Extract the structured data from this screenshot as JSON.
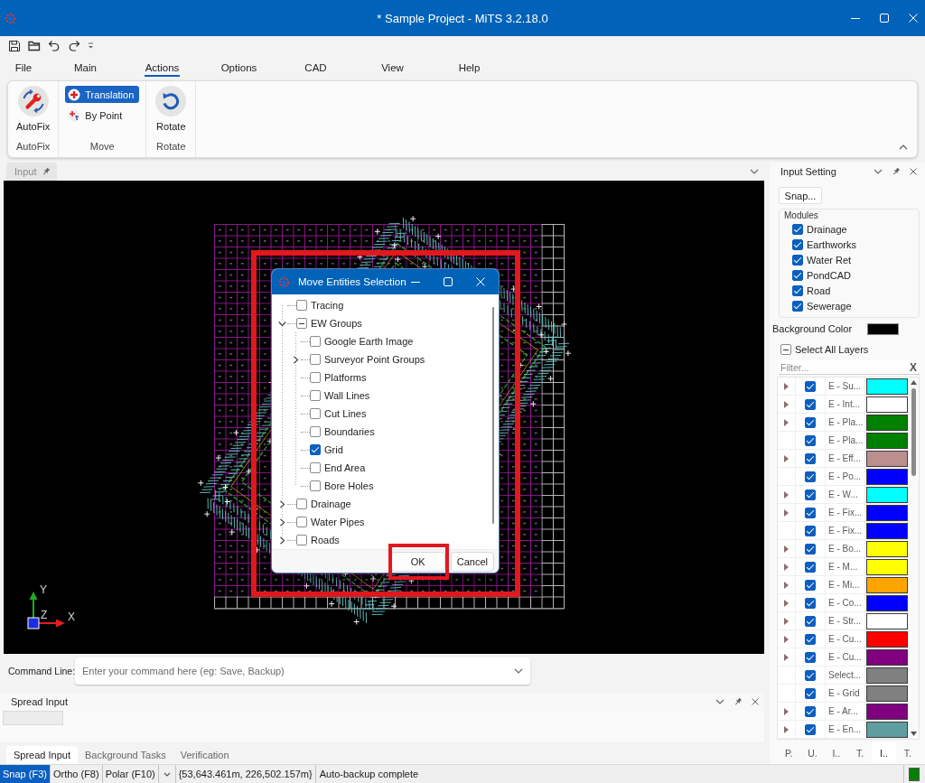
{
  "window": {
    "title": "* Sample Project - MiTS 3.2.18.0"
  },
  "menu_tabs": [
    {
      "label": "File",
      "selected": false
    },
    {
      "label": "Main",
      "selected": false
    },
    {
      "label": "Actions",
      "selected": true
    },
    {
      "label": "Options",
      "selected": false
    },
    {
      "label": "CAD",
      "selected": false
    },
    {
      "label": "View",
      "selected": false
    },
    {
      "label": "Help",
      "selected": false
    }
  ],
  "ribbon": {
    "groups": [
      {
        "label": "AutoFix",
        "buttons": [
          {
            "kind": "large",
            "label": "AutoFix",
            "selected": false
          }
        ]
      },
      {
        "label": "Move",
        "buttons": [
          {
            "kind": "small",
            "label": "Translation",
            "selected": true
          },
          {
            "kind": "small",
            "label": "By Point",
            "selected": false
          }
        ]
      },
      {
        "label": "Rotate",
        "buttons": [
          {
            "kind": "large",
            "label": "Rotate",
            "selected": false
          }
        ]
      }
    ]
  },
  "document_tab": {
    "label": "Input"
  },
  "canvas": {
    "axis_labels": [
      "Y",
      "Z",
      "X"
    ]
  },
  "dialog": {
    "title": "Move Entities Selection",
    "tree": [
      {
        "label": "Tracing",
        "checked": false,
        "indeterminate": false
      },
      {
        "label": "EW Groups",
        "checked": false,
        "indeterminate": true,
        "expanded": true,
        "children": [
          {
            "label": "Google Earth Image",
            "checked": false,
            "indeterminate": false
          },
          {
            "label": "Surveyor Point Groups",
            "checked": false,
            "indeterminate": false,
            "expanded": false
          },
          {
            "label": "Platforms",
            "checked": false,
            "indeterminate": false
          },
          {
            "label": "Wall Lines",
            "checked": false,
            "indeterminate": false
          },
          {
            "label": "Cut Lines",
            "checked": false,
            "indeterminate": false
          },
          {
            "label": "Boundaries",
            "checked": false,
            "indeterminate": false
          },
          {
            "label": "Grid",
            "checked": true,
            "indeterminate": false
          },
          {
            "label": "End Area",
            "checked": false,
            "indeterminate": false
          },
          {
            "label": "Bore Holes",
            "checked": false,
            "indeterminate": false
          }
        ]
      },
      {
        "label": "Drainage",
        "checked": false,
        "indeterminate": false,
        "expanded": false
      },
      {
        "label": "Water Pipes",
        "checked": false,
        "indeterminate": false,
        "expanded": false
      },
      {
        "label": "Roads",
        "checked": false,
        "indeterminate": false,
        "expanded": false
      }
    ],
    "buttons": [
      {
        "label": "OK",
        "highlighted": true
      },
      {
        "label": "Cancel",
        "highlighted": false
      }
    ]
  },
  "command_line": {
    "label": "Command Line:",
    "placeholder": "Enter your command here (eg: Save, Backup)"
  },
  "spread_input": {
    "title": "Spread Input"
  },
  "bottom_tabs": [
    {
      "label": "Spread Input",
      "selected": true
    },
    {
      "label": "Background Tasks",
      "selected": false
    },
    {
      "label": "Verification",
      "selected": false
    }
  ],
  "input_setting": {
    "title": "Input Setting",
    "snap_button": "Snap...",
    "modules": {
      "label": "Modules",
      "items": [
        {
          "label": "Drainage",
          "checked": true
        },
        {
          "label": "Earthworks",
          "checked": true
        },
        {
          "label": "Water Ret",
          "checked": true
        },
        {
          "label": "PondCAD",
          "checked": true
        },
        {
          "label": "Road",
          "checked": true
        },
        {
          "label": "Sewerage",
          "checked": true
        }
      ]
    },
    "background_color": {
      "label": "Background Color",
      "color": "#000000"
    },
    "select_all_layers": {
      "label": "Select All Layers",
      "checked": false,
      "indeterminate": true
    },
    "filter": {
      "placeholder": "Filter...",
      "clear_label": "X"
    },
    "layers": [
      {
        "name": "E - Su...",
        "expandable": true,
        "checked": true,
        "color": "#00ffff"
      },
      {
        "name": "E - Int...",
        "expandable": true,
        "checked": true,
        "color": "#ffffff"
      },
      {
        "name": "E - Pla...",
        "expandable": true,
        "checked": true,
        "color": "#008000"
      },
      {
        "name": "E - Pla...",
        "expandable": false,
        "checked": true,
        "color": "#008000"
      },
      {
        "name": "E - Eff...",
        "expandable": true,
        "checked": true,
        "color": "#bc8f8f"
      },
      {
        "name": "E - Po...",
        "expandable": false,
        "checked": true,
        "color": "#0000ff"
      },
      {
        "name": "E - W...",
        "expandable": true,
        "checked": true,
        "color": "#00ffff"
      },
      {
        "name": "E - Fix...",
        "expandable": true,
        "checked": true,
        "color": "#0000ff"
      },
      {
        "name": "E - Fix...",
        "expandable": false,
        "checked": true,
        "color": "#0000ff"
      },
      {
        "name": "E - Bo...",
        "expandable": true,
        "checked": true,
        "color": "#ffff00"
      },
      {
        "name": "E - M...",
        "expandable": true,
        "checked": true,
        "color": "#ffff00"
      },
      {
        "name": "E - Mi...",
        "expandable": true,
        "checked": true,
        "color": "#ffa500"
      },
      {
        "name": "E - Co...",
        "expandable": true,
        "checked": true,
        "color": "#0000ff"
      },
      {
        "name": "E - Str...",
        "expandable": true,
        "checked": true,
        "color": "#ffffff"
      },
      {
        "name": "E - Cu...",
        "expandable": true,
        "checked": true,
        "color": "#ff0000"
      },
      {
        "name": "E - Cu...",
        "expandable": true,
        "checked": true,
        "color": "#800080"
      },
      {
        "name": "Select...",
        "expandable": false,
        "checked": true,
        "color": "#808080"
      },
      {
        "name": "E - Grid",
        "expandable": false,
        "checked": true,
        "color": "#808080"
      },
      {
        "name": "E - Ar...",
        "expandable": true,
        "checked": true,
        "color": "#800080"
      },
      {
        "name": "E - En...",
        "expandable": true,
        "checked": true,
        "color": "#5f9ea0"
      }
    ],
    "tabs": [
      {
        "label": "P.",
        "selected": false
      },
      {
        "label": "U.",
        "selected": false
      },
      {
        "label": "I..",
        "selected": false
      },
      {
        "label": "T.",
        "selected": false
      },
      {
        "label": "I..",
        "selected": true
      },
      {
        "label": "T.",
        "selected": false
      }
    ]
  },
  "status_bar": {
    "toggles": [
      {
        "label": "Snap (F3)",
        "on": true
      },
      {
        "label": "Ortho (F8)",
        "on": false
      },
      {
        "label": "Polar (F10)",
        "on": false
      }
    ],
    "coordinates": "{53,643.461m, 226,502.157m}",
    "message": "Auto-backup complete"
  }
}
